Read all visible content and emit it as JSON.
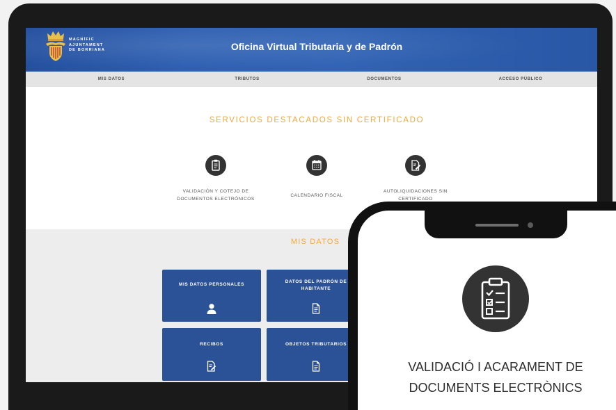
{
  "colors": {
    "page_background": "#f2f2f2",
    "device_frame": "#1a1a1a",
    "header_blue": "#2f60b2",
    "nav_background": "#e4e4e4",
    "accent_orange": "#f0a83c",
    "tile_blue": "#2b5196",
    "icon_circle": "#333333",
    "section_gray": "#ededed",
    "logo_gold": "#e8bf4a"
  },
  "laptop": {
    "header": {
      "logo": {
        "icon": "coat-of-arms-icon",
        "lines": [
          "MAGNÍFIC",
          "AJUNTAMENT",
          "DE BORRIANA"
        ]
      },
      "title": "Oficina Virtual Tributaria y de Padrón"
    },
    "nav": {
      "items": [
        "MIS DATOS",
        "TRIBUTOS",
        "DOCUMENTOS",
        "ACCESO PÚBLICO"
      ]
    },
    "featured": {
      "heading": "SERVICIOS DESTACADOS SIN CERTIFICADO",
      "services": [
        {
          "icon": "clipboard-icon",
          "label_lines": [
            "VALIDACIÓN Y COTEJO DE",
            "DOCUMENTOS ELECTRÓNICOS"
          ]
        },
        {
          "icon": "calendar-icon",
          "label_lines": [
            "CALENDARIO FISCAL"
          ]
        },
        {
          "icon": "document-edit-icon",
          "label_lines": [
            "AUTOLIQUIDACIONES SIN",
            "CERTIFICADO"
          ]
        }
      ]
    },
    "my_data": {
      "heading": "MIS DATOS",
      "tiles": [
        {
          "icon": "user-icon",
          "label_lines": [
            "MIS DATOS PERSONALES"
          ]
        },
        {
          "icon": "document-icon",
          "label_lines": [
            "DATOS DEL PADRÓN DE",
            "HABITANTE"
          ]
        },
        {
          "icon": "receipt-icon",
          "label_lines": [
            "RECIBOS"
          ]
        },
        {
          "icon": "document-icon",
          "label_lines": [
            "OBJETOS TRIBUTARIOS"
          ]
        }
      ]
    }
  },
  "phone": {
    "icon": "clipboard-checklist-icon",
    "title_lines": [
      "VALIDACIÓ I ACARAMENT DE",
      "DOCUMENTS ELECTRÒNICS"
    ]
  }
}
